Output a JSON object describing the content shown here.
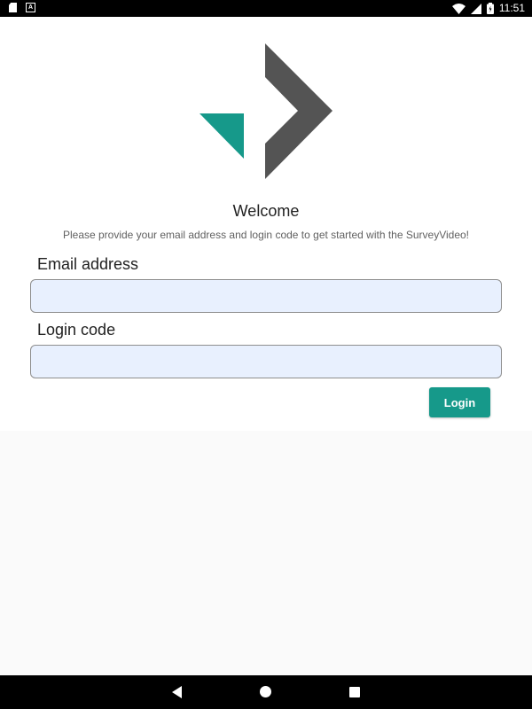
{
  "status_bar": {
    "time": "11:51",
    "icons": [
      "sd-card-icon",
      "a-notification-icon",
      "wifi-icon",
      "signal-icon",
      "battery-icon"
    ]
  },
  "logo": {
    "colors": {
      "teal": "#16998a",
      "gray": "#545454"
    }
  },
  "welcome": {
    "title": "Welcome",
    "subtitle": "Please provide your email address and login code to get started with the SurveyVideo!"
  },
  "form": {
    "email_label": "Email address",
    "email_value": "",
    "code_label": "Login code",
    "code_value": "",
    "login_label": "Login"
  },
  "colors": {
    "accent": "#16998a",
    "input_background": "#e8f0fe"
  },
  "nav_bar": {
    "icons": [
      "back-icon",
      "home-icon",
      "recents-icon"
    ]
  }
}
